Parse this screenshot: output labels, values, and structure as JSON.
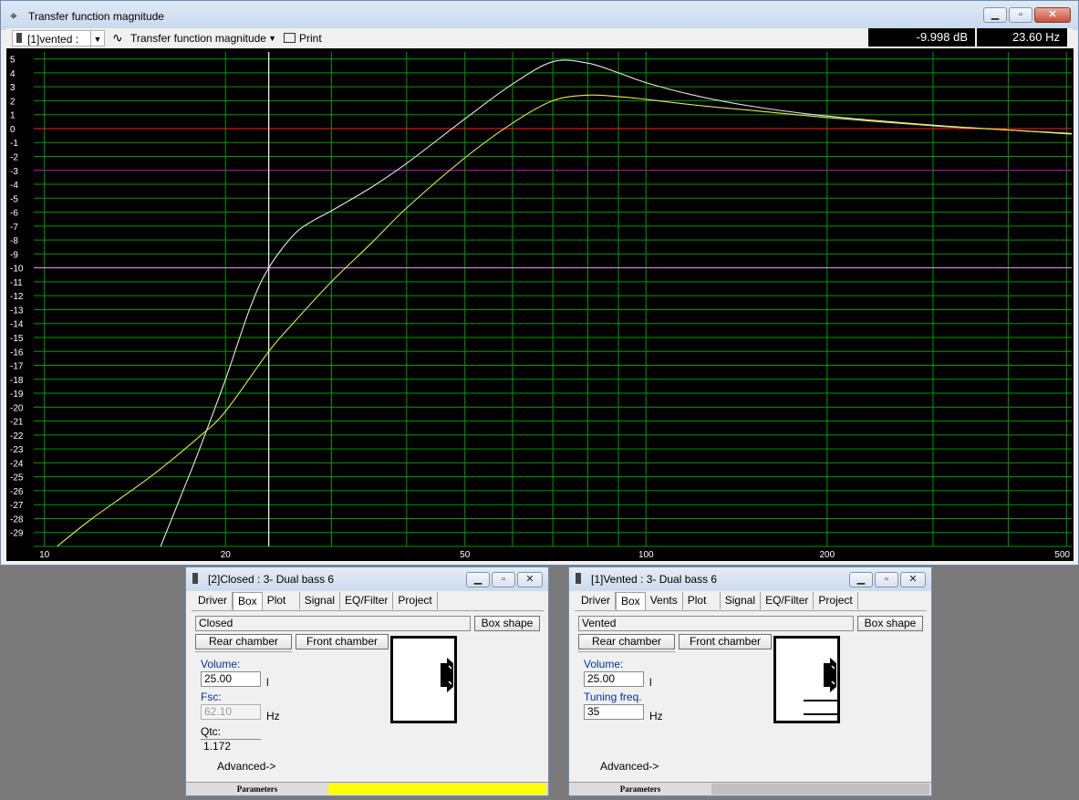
{
  "main_window": {
    "title": "Transfer function magnitude",
    "toolbar": {
      "system_select": "[1]vented :",
      "plot_select": "Transfer function magnitude",
      "print_label": "Print"
    },
    "readout_db": "-9.998 dB",
    "readout_hz": "23.60 Hz",
    "icons": {
      "app": "crosshair-icon",
      "minimize": "minimize-icon",
      "maximize": "maximize-icon",
      "close": "close-icon"
    }
  },
  "chart_data": {
    "type": "line",
    "title": "",
    "xlabel": "",
    "ylabel": "",
    "x_scale": "log",
    "xlim": [
      9.6,
      510
    ],
    "ylim": [
      -30,
      5.5
    ],
    "x_ticks": [
      "10",
      "20",
      "50",
      "100",
      "200",
      "500"
    ],
    "y_ticks": [
      "5",
      "4",
      "3",
      "2",
      "1",
      "0",
      "-1",
      "-2",
      "-3",
      "-4",
      "-5",
      "-6",
      "-7",
      "-8",
      "-9",
      "-10",
      "-11",
      "-12",
      "-13",
      "-14",
      "-15",
      "-16",
      "-17",
      "-18",
      "-19",
      "-20",
      "-21",
      "-22",
      "-23",
      "-24",
      "-25",
      "-26",
      "-27",
      "-28",
      "-29"
    ],
    "grid": true,
    "background": "#000000",
    "grid_color": "#009a00",
    "reference_lines": [
      {
        "y": 0,
        "color": "#ff2020"
      },
      {
        "y": -3,
        "color": "#c000c0"
      },
      {
        "y": -10,
        "color": "#ff80ff"
      }
    ],
    "cursor_x": 23.6,
    "series": [
      {
        "color": "#e8e8e8",
        "x": [
          15.6,
          17,
          18,
          20,
          22,
          23.6,
          26,
          28,
          30,
          35,
          40,
          50,
          60,
          70,
          80,
          90,
          100,
          120,
          150,
          200,
          300,
          400,
          510
        ],
        "y": [
          -30,
          -26,
          -23.3,
          -18,
          -12.8,
          -10,
          -7.6,
          -6.6,
          -5.9,
          -4.2,
          -2.5,
          0.7,
          3.2,
          4.8,
          4.7,
          4.0,
          3.3,
          2.4,
          1.6,
          0.9,
          0.25,
          -0.1,
          -0.35
        ]
      },
      {
        "color": "#e8e844",
        "x": [
          10.5,
          12,
          15,
          18,
          20,
          23.6,
          26,
          30,
          35,
          40,
          50,
          60,
          70,
          80,
          90,
          100,
          120,
          150,
          200,
          300,
          400,
          510
        ],
        "y": [
          -30,
          -28,
          -25,
          -22.2,
          -20.3,
          -16,
          -13.9,
          -11,
          -8.2,
          -5.7,
          -2.1,
          0.4,
          2.0,
          2.4,
          2.3,
          2.1,
          1.7,
          1.3,
          0.8,
          0.2,
          -0.1,
          -0.4
        ]
      }
    ]
  },
  "closed_window": {
    "title": "[2]Closed : 3- Dual bass 6",
    "tabs": [
      "Driver",
      "Box",
      "Plot",
      "Signal",
      "EQ/Filter",
      "Project"
    ],
    "active_tab": "Box",
    "box_type": "Closed",
    "box_shape_button": "Box shape",
    "rear_chamber": "Rear chamber",
    "front_chamber": "Front chamber",
    "volume_label": "Volume:",
    "volume_value": "25.00",
    "volume_unit": "l",
    "fsc_label": "Fsc:",
    "fsc_value": "62.10",
    "fsc_unit": "Hz",
    "qtc_label": "Qtc:",
    "qtc_value": "1.172",
    "advanced": "Advanced->",
    "status_params": "Parameters",
    "status_color": "#ffff00"
  },
  "vented_window": {
    "title": "[1]Vented : 3- Dual bass 6",
    "tabs": [
      "Driver",
      "Box",
      "Vents",
      "Plot",
      "Signal",
      "EQ/Filter",
      "Project"
    ],
    "active_tab": "Box",
    "box_type": "Vented",
    "box_shape_button": "Box shape",
    "rear_chamber": "Rear chamber",
    "front_chamber": "Front chamber",
    "volume_label": "Volume:",
    "volume_value": "25.00",
    "volume_unit": "l",
    "tuning_label": "Tuning freq.",
    "tuning_value": "35",
    "tuning_unit": "Hz",
    "advanced": "Advanced->",
    "status_params": "Parameters",
    "status_color": "#c0c0c0"
  }
}
